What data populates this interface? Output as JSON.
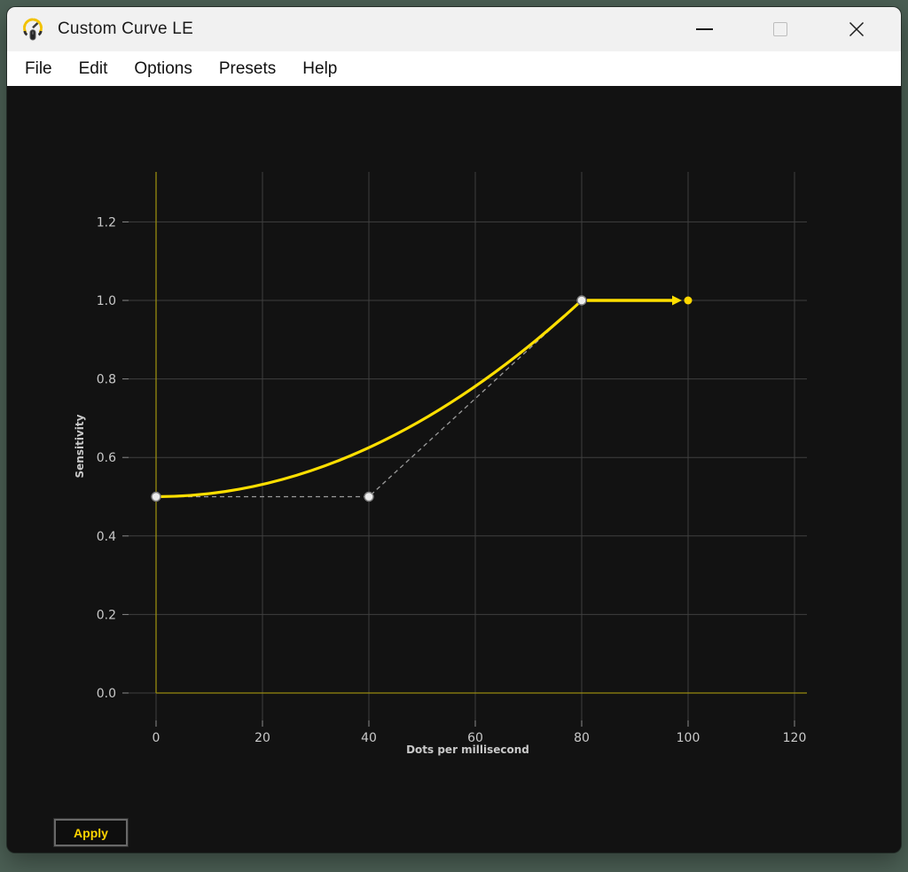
{
  "window": {
    "title": "Custom Curve LE",
    "desktop_background": "#4b5f54",
    "titlebar_background": "#f1f1f1",
    "content_background": "#121212"
  },
  "menu": {
    "items": [
      {
        "label": "File"
      },
      {
        "label": "Edit"
      },
      {
        "label": "Options"
      },
      {
        "label": "Presets"
      },
      {
        "label": "Help"
      }
    ]
  },
  "chart_data": {
    "type": "line",
    "title": "",
    "xlabel": "Dots per millisecond",
    "ylabel": "Sensitivity",
    "x_ticks": [
      0,
      20,
      40,
      60,
      80,
      100,
      120
    ],
    "y_ticks": [
      0.0,
      0.2,
      0.4,
      0.6,
      0.8,
      1.0,
      1.2
    ],
    "xlim": [
      -5.2,
      122.3
    ],
    "ylim": [
      -0.07,
      1.33
    ],
    "grid": true,
    "legend": false,
    "series": [
      {
        "name": "sensitivity-curve",
        "type": "quadratic_bezier",
        "points": [
          [
            0,
            0.5
          ],
          [
            40,
            0.5
          ],
          [
            80,
            1.0
          ]
        ],
        "color": "#ffdf00"
      },
      {
        "name": "control-polygon",
        "type": "dashed_line",
        "points": [
          [
            0,
            0.5
          ],
          [
            40,
            0.5
          ],
          [
            80,
            1.0
          ]
        ],
        "color": "#9a9a9a"
      },
      {
        "name": "extension-arrow",
        "type": "arrow",
        "points": [
          [
            80,
            1.0
          ],
          [
            100,
            1.0
          ]
        ],
        "color": "#ffdf00"
      }
    ],
    "anchor_points": [
      [
        0,
        0.5
      ],
      [
        40,
        0.5
      ],
      [
        80,
        1.0
      ]
    ],
    "end_point": [
      100,
      1.0
    ],
    "colors": {
      "grid": "#3f3f3f",
      "tick_mark": "#8a8a8a",
      "tick_label": "#c9c9c9",
      "axis_label": "#c9c9c9",
      "zero_axis": "#978a10",
      "curve": "#ffdf00",
      "dashed": "#9a9a9a",
      "anchor_fill": "#ececec",
      "anchor_stroke": "#7f7f7f",
      "end_dot": "#ffd700"
    }
  },
  "apply_button": {
    "label": "Apply",
    "text_color": "#ffd400"
  }
}
